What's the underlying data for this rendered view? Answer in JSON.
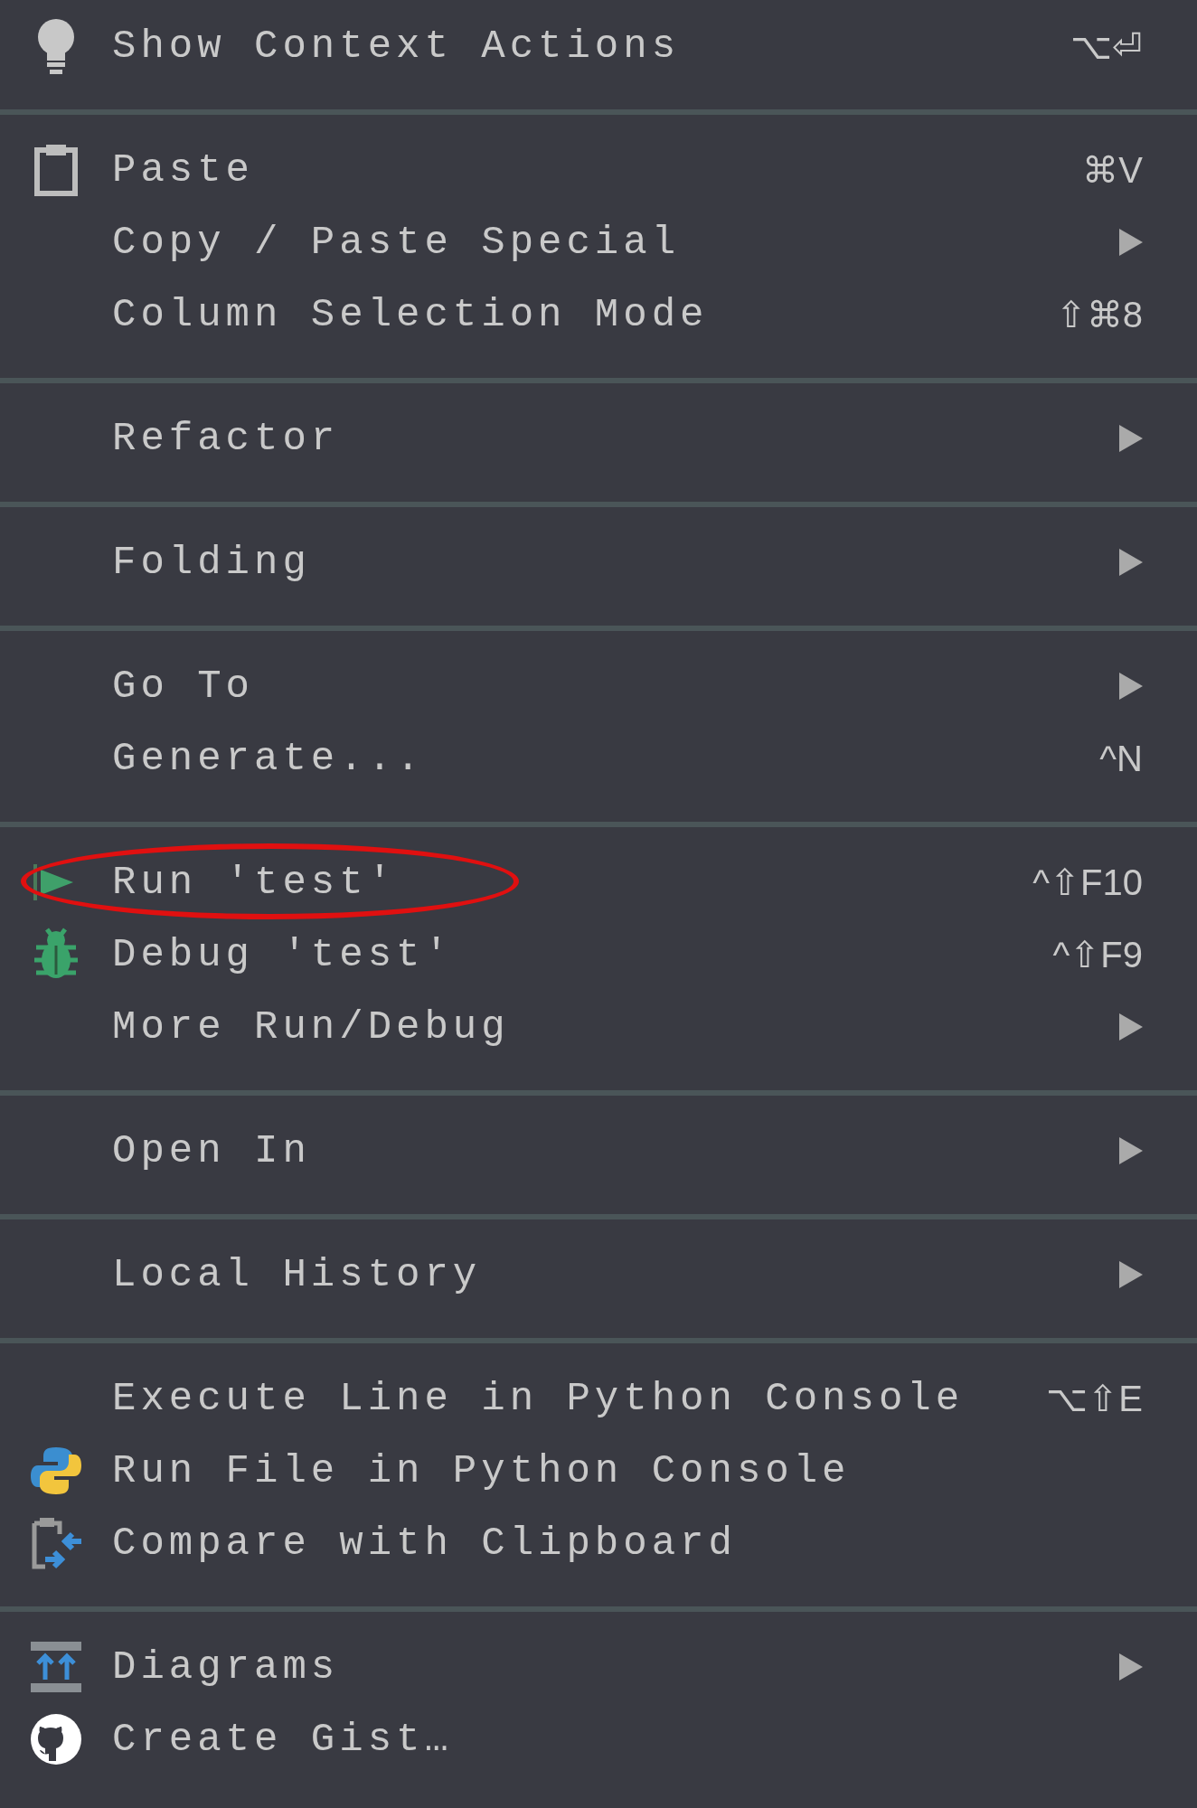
{
  "menu": {
    "groups": [
      {
        "items": [
          {
            "label": "Show Context Actions",
            "shortcut": "⌥⏎",
            "submenu": false,
            "circled": false
          }
        ]
      },
      {
        "items": [
          {
            "label": "Paste",
            "shortcut": "⌘V",
            "submenu": false,
            "circled": false
          },
          {
            "label": "Copy / Paste Special",
            "submenu": true,
            "circled": false
          },
          {
            "label": "Column Selection Mode",
            "shortcut": "⇧⌘8",
            "submenu": false,
            "circled": false
          }
        ]
      },
      {
        "items": [
          {
            "label": "Refactor",
            "submenu": true,
            "circled": false
          }
        ]
      },
      {
        "items": [
          {
            "label": "Folding",
            "submenu": true,
            "circled": false
          }
        ]
      },
      {
        "items": [
          {
            "label": "Go To",
            "submenu": true,
            "circled": false
          },
          {
            "label": "Generate...",
            "shortcut": "^N",
            "submenu": false,
            "circled": false
          }
        ]
      },
      {
        "items": [
          {
            "label": "Run 'test'",
            "shortcut": "^⇧F10",
            "submenu": false,
            "circled": true
          },
          {
            "label": "Debug 'test'",
            "shortcut": "^⇧F9",
            "submenu": false,
            "circled": false
          },
          {
            "label": "More Run/Debug",
            "submenu": true,
            "circled": false
          }
        ]
      },
      {
        "items": [
          {
            "label": "Open In",
            "submenu": true,
            "circled": false
          }
        ]
      },
      {
        "items": [
          {
            "label": "Local History",
            "submenu": true,
            "circled": false
          }
        ]
      },
      {
        "items": [
          {
            "label": "Execute Line in Python Console",
            "shortcut": "⌥⇧E",
            "submenu": false,
            "circled": false
          },
          {
            "label": "Run File in Python Console",
            "submenu": false,
            "circled": false
          },
          {
            "label": "Compare with Clipboard",
            "submenu": false,
            "circled": false
          }
        ]
      },
      {
        "items": [
          {
            "label": "Diagrams",
            "submenu": true,
            "circled": false
          },
          {
            "label": "Create Gist…",
            "submenu": false,
            "circled": false
          }
        ]
      }
    ]
  }
}
